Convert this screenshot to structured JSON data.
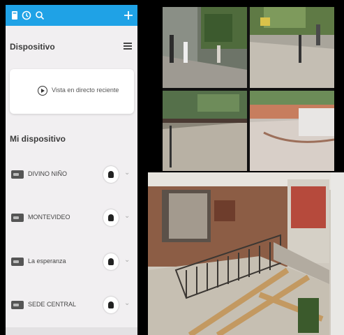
{
  "header": {
    "icons": [
      "device-icon",
      "history-icon",
      "search-icon",
      "add-icon"
    ]
  },
  "section1": {
    "title": "Dispositivo"
  },
  "live": {
    "label": "Vista en directo reciente"
  },
  "section2": {
    "title": "Mi dispositivo"
  },
  "devices": [
    {
      "name": "DIVINO NIÑO"
    },
    {
      "name": "MONTEVIDEO"
    },
    {
      "name": "La esperanza"
    },
    {
      "name": "SEDE CENTRAL"
    }
  ],
  "colors": {
    "accent": "#1fa2e6",
    "background": "#f1eff1"
  }
}
